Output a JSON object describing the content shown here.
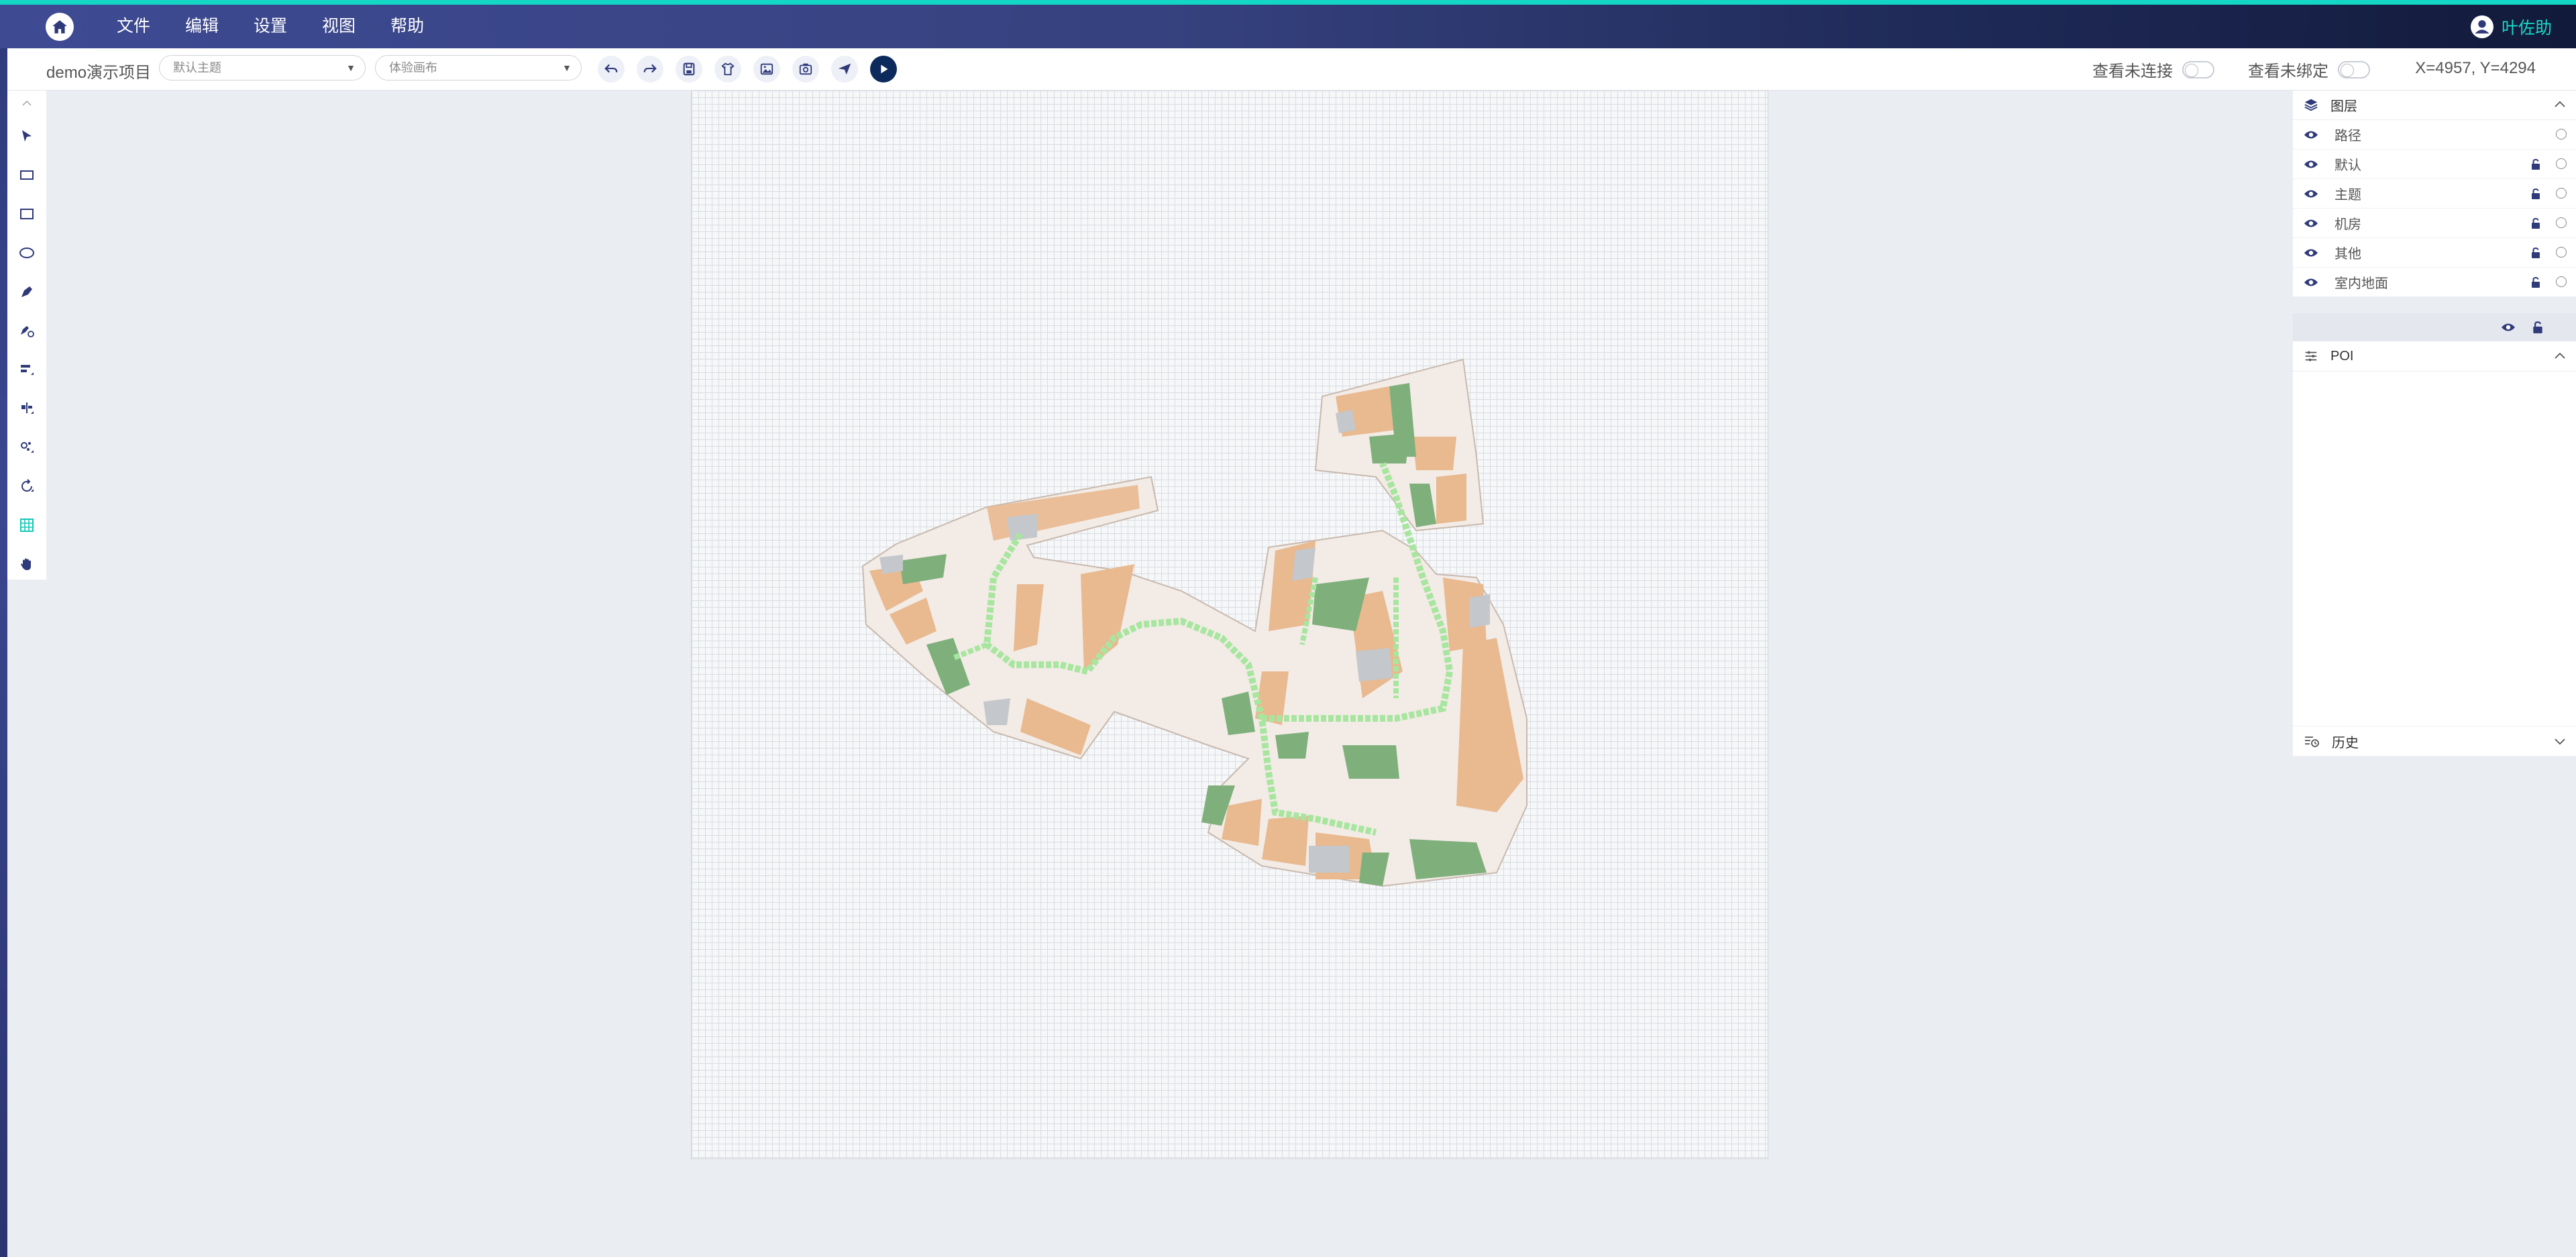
{
  "app": {
    "menu": [
      "文件",
      "编辑",
      "设置",
      "视图",
      "帮助"
    ],
    "user_name": "叶佐助",
    "colors": {
      "accent": "#14d6c4",
      "header": "#36427f",
      "path_green": "#a8e6a0",
      "building_orange": "#e9b98f",
      "zone_green": "#7fb07c",
      "zone_gray": "#c4c7cb"
    }
  },
  "toolbar": {
    "project_name": "demo演示项目",
    "theme_select": "默认主题",
    "canvas_select": "体验画布",
    "toggle_unconnected": "查看未连接",
    "toggle_unbound": "查看未绑定",
    "coords": "X=4957, Y=4294",
    "icons": [
      "undo-icon",
      "redo-icon",
      "save-icon",
      "theme-icon",
      "image-icon",
      "screenshot-icon",
      "send-icon",
      "play-icon"
    ]
  },
  "palette": {
    "icons": [
      "select-arrow-icon",
      "rectangle-icon",
      "rectangle-outline-icon",
      "ellipse-icon",
      "pen-icon",
      "pen-add-icon",
      "align-left-icon",
      "align-center-icon",
      "node-edit-icon",
      "rotate-icon",
      "grid-icon",
      "hand-icon"
    ]
  },
  "panel": {
    "layers_title": "图层",
    "layers": [
      {
        "name": "路径",
        "locked": false
      },
      {
        "name": "默认",
        "locked": true
      },
      {
        "name": "主题",
        "locked": true
      },
      {
        "name": "机房",
        "locked": true
      },
      {
        "name": "其他",
        "locked": true
      },
      {
        "name": "室内地面",
        "locked": true
      }
    ],
    "poi_title": "POI",
    "history_title": "历史"
  }
}
